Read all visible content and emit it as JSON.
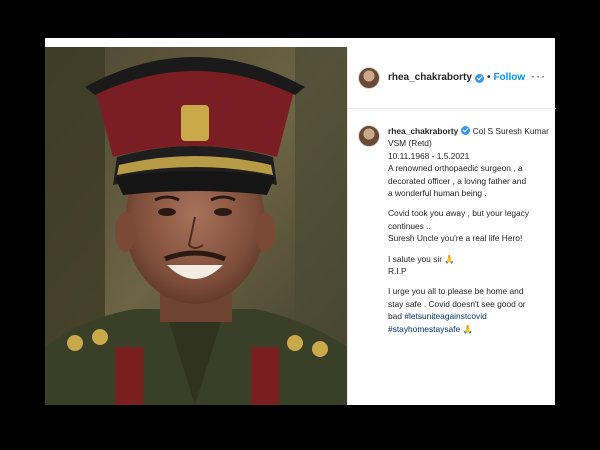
{
  "post": {
    "username": "rhea_chakraborty",
    "follow_label": "Follow",
    "separator": "•",
    "more_label": "···"
  },
  "caption": {
    "username": "rhea_chakraborty",
    "title": "Col S Suresh Kumar VSM (Retd)",
    "dates": "10.11.1968 - 1.5.2021",
    "para1": [
      "A renowned orthopaedic surgeon , a",
      "decorated officer , a loving father and",
      "a wonderful human being ."
    ],
    "para2": [
      "Covid took you away , but your legacy",
      "continues ..",
      "Suresh Uncle you're a real life Hero!"
    ],
    "salute": "I salute you sir 🙏",
    "rip": "R.I.P",
    "para3": [
      "I urge you all to please be home and",
      "stay safe . Covid doesn't see good or",
      "bad"
    ],
    "hashtag1": "#letsuniteagainstcovid",
    "hashtag2": "#stayhomestaysafe",
    "hashtag2_suffix": " 🙏"
  },
  "colors": {
    "link": "#0095f6",
    "hashtag": "#00376b",
    "verified": "#3897f0"
  }
}
